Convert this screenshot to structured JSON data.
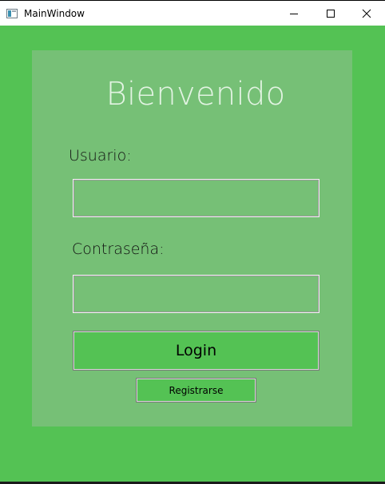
{
  "window": {
    "title": "MainWindow",
    "icons": {
      "app": "app-window-icon",
      "minimize": "minimize-icon",
      "maximize": "maximize-icon",
      "close": "close-icon"
    }
  },
  "login": {
    "heading": "Bienvenido",
    "username_label": "Usuario:",
    "username_value": "",
    "password_label": "Contraseña:",
    "password_value": "",
    "login_button": "Login",
    "register_button": "Registrarse"
  },
  "colors": {
    "window_background": "#54c254",
    "panel_background": "#76c076",
    "heading_text": "#e2f3e2"
  }
}
